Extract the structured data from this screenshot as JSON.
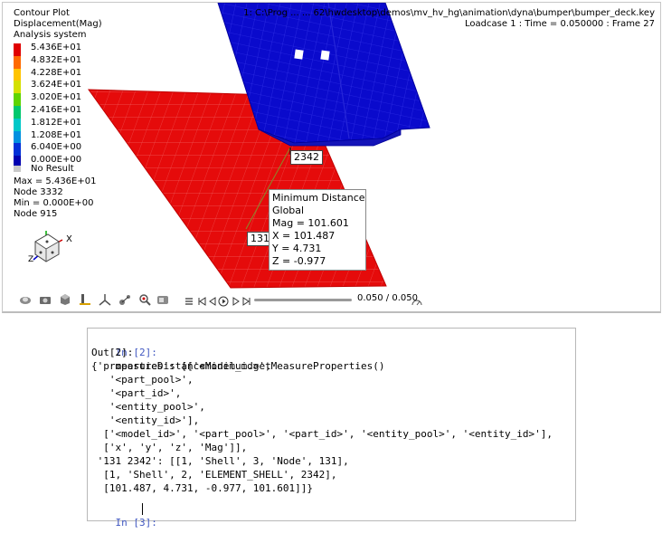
{
  "legend": {
    "title_lines": [
      "Contour Plot",
      "Displacement(Mag)",
      "Analysis system"
    ],
    "entries": [
      {
        "label": "5.436E+01",
        "color": "#e00000"
      },
      {
        "label": "4.832E+01",
        "color": "#ff6a00"
      },
      {
        "label": "4.228E+01",
        "color": "#ffc400"
      },
      {
        "label": "3.624E+01",
        "color": "#d4e000"
      },
      {
        "label": "3.020E+01",
        "color": "#5ed400"
      },
      {
        "label": "2.416E+01",
        "color": "#00c86e"
      },
      {
        "label": "1.812E+01",
        "color": "#00c8c8"
      },
      {
        "label": "1.208E+01",
        "color": "#0090e0"
      },
      {
        "label": "6.040E+00",
        "color": "#0030d8"
      },
      {
        "label": "0.000E+00",
        "color": "#0000b0"
      }
    ],
    "no_result": {
      "label": "No Result",
      "color": "#c8c8c8"
    },
    "max_line": "Max = 5.436E+01",
    "max_node": "Node 3332",
    "min_line": "Min = 0.000E+00",
    "min_node": "Node 915"
  },
  "header": {
    "path": "1: C:\\Prog          ...  ...          62\\hwdesktop\\demos\\mv_hv_hg\\animation\\dyna\\bumper\\bumper_deck.key",
    "loadcase": "Loadcase 1 : Time = 0.050000 : Frame 27"
  },
  "labels": {
    "node_a": "2342",
    "node_b": "131",
    "axis_x": "X",
    "axis_z": "Z"
  },
  "measure": {
    "title": "Minimum Distance",
    "system": "Global",
    "mag": "Mag = 101.601",
    "x": "X = 101.487",
    "y": "Y = 4.731",
    "z": "Z = -0.977"
  },
  "toolbar": {
    "tool_icons": [
      "view-icon",
      "camera-icon",
      "cube-icon",
      "marker-icon",
      "axes-icon",
      "measure-icon",
      "zoom-icon",
      "capture-icon",
      "link-icon"
    ],
    "time_label": "0.050 / 0.050"
  },
  "notebook": {
    "in2_prompt": "In [2]:",
    "in2_code": "measureDistanceMinimum.getMeasureProperties()",
    "out2_prompt": "Out[2]:",
    "output_lines": [
      "{'properties': [['<model_id>',",
      "   '<part_pool>',",
      "   '<part_id>',",
      "   '<entity_pool>',",
      "   '<entity_id>'],",
      "  ['<model_id>', '<part_pool>', '<part_id>', '<entity_pool>', '<entity_id>'],",
      "  ['x', 'y', 'z', 'Mag']],",
      " '131 2342': [[1, 'Shell', 3, 'Node', 131],",
      "  [1, 'Shell', 2, 'ELEMENT_SHELL', 2342],",
      "  [101.487, 4.731, -0.977, 101.601]]}"
    ],
    "in3_prompt": "In [3]:"
  }
}
